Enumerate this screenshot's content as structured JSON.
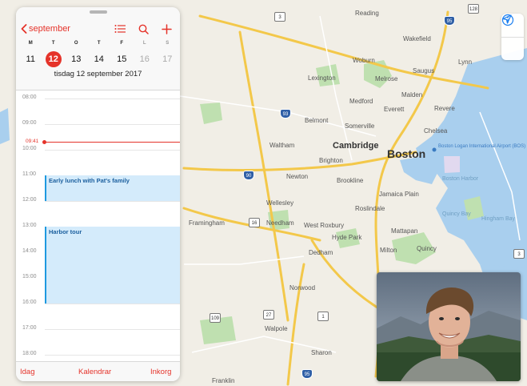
{
  "calendar": {
    "back_label": "september",
    "weekdays": [
      "M",
      "T",
      "O",
      "T",
      "F",
      "L",
      "S"
    ],
    "days": [
      "11",
      "12",
      "13",
      "14",
      "15",
      "16",
      "17"
    ],
    "selected_day": "12",
    "date_title": "tisdag 12 september 2017",
    "hours": [
      "08:00",
      "09:00",
      "10:00",
      "11:00",
      "12:00",
      "13:00",
      "14:00",
      "15:00",
      "16:00",
      "17:00",
      "18:00"
    ],
    "now_label": "09:41",
    "events": [
      {
        "title": "Early lunch with Pat's family"
      },
      {
        "title": "Harbor tour"
      }
    ],
    "tabs": {
      "today": "Idag",
      "calendars": "Kalendrar",
      "inbox": "Inkorg"
    }
  },
  "map": {
    "labels": {
      "reading": "Reading",
      "wakefield": "Wakefield",
      "woburn": "Woburn",
      "lynn": "Lynn",
      "saugus": "Saugus",
      "lexington": "Lexington",
      "melrose": "Melrose",
      "malden": "Malden",
      "medford": "Medford",
      "everett": "Everett",
      "revere": "Revere",
      "belmont": "Belmont",
      "somerville": "Somerville",
      "chelsea": "Chelsea",
      "waltham": "Waltham",
      "cambridge": "Cambridge",
      "boston": "Boston",
      "airport": "Boston Logan International Airport (BOS)",
      "brighton": "Brighton",
      "newton": "Newton",
      "brookline": "Brookline",
      "boston_harbor": "Boston Harbor",
      "jamaica_plain": "Jamaica Plain",
      "wellesley": "Wellesley",
      "framingham": "Framingham",
      "needham": "Needham",
      "west_roxbury": "West Roxbury",
      "roslindale": "Roslindale",
      "hyde_park": "Hyde Park",
      "mattapan": "Mattapan",
      "quincy_bay": "Quincy Bay",
      "hingham_bay": "Hingham Bay",
      "dedham": "Dedham",
      "milton": "Milton",
      "quincy": "Quincy",
      "norwood": "Norwood",
      "walpole": "Walpole",
      "sharon": "Sharon",
      "franklin": "Franklin"
    },
    "shields": {
      "r3": "3",
      "r128": "128",
      "i95n": "95",
      "i93": "93",
      "i90a": "90",
      "i90b": "90",
      "r16": "16",
      "r109": "109",
      "r27": "27",
      "r1": "1",
      "r3b": "3",
      "i95s": "95",
      "r128b": "128"
    }
  },
  "colors": {
    "accent": "#e5332a",
    "event_fill": "#d4ebfb",
    "event_border": "#1f9ae0",
    "water": "#a9cfee",
    "park": "#bfe0b0"
  },
  "icons": {
    "info": "info-icon",
    "location": "location-arrow-icon",
    "list": "list-icon",
    "search": "search-icon",
    "add": "plus-icon",
    "back": "chevron-left-icon"
  }
}
